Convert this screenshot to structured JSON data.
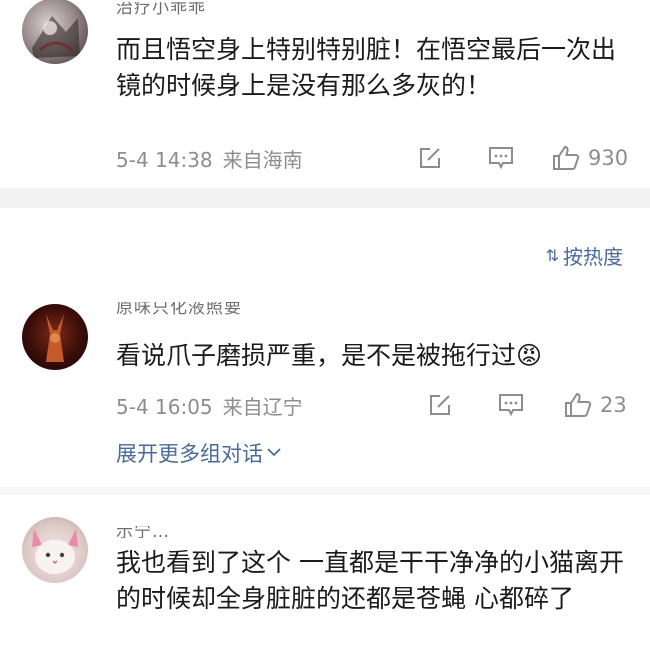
{
  "comments": [
    {
      "username": "治疗小乖乖",
      "text": "而且悟空身上特别特别脏！在悟空最后一次出镜的时候身上是没有那么多灰的！",
      "time": "5-4 14:38",
      "location": "来自海南",
      "likes": "930"
    },
    {
      "username": "原味只化液照要",
      "text": "看说爪子磨损严重，是不是被拖行过😡",
      "time": "5-4 16:05",
      "location": "来自辽宁",
      "likes": "23"
    },
    {
      "username": "示宁…",
      "text": "我也看到了这个 一直都是干干净净的小猫离开的时候却全身脏脏的还都是苍蝇 心都碎了"
    }
  ],
  "sort": {
    "icon": "sort-icon",
    "label": "按热度"
  },
  "expand": {
    "label": "展开更多组对话"
  },
  "icons": {
    "share": "share-icon",
    "comment": "comment-icon",
    "like": "thumbs-up-icon",
    "expand": "chevron-down-icon"
  },
  "colors": {
    "link": "#4a6a9a",
    "meta": "#8d8d8d",
    "divider": "#f2f2f2"
  }
}
